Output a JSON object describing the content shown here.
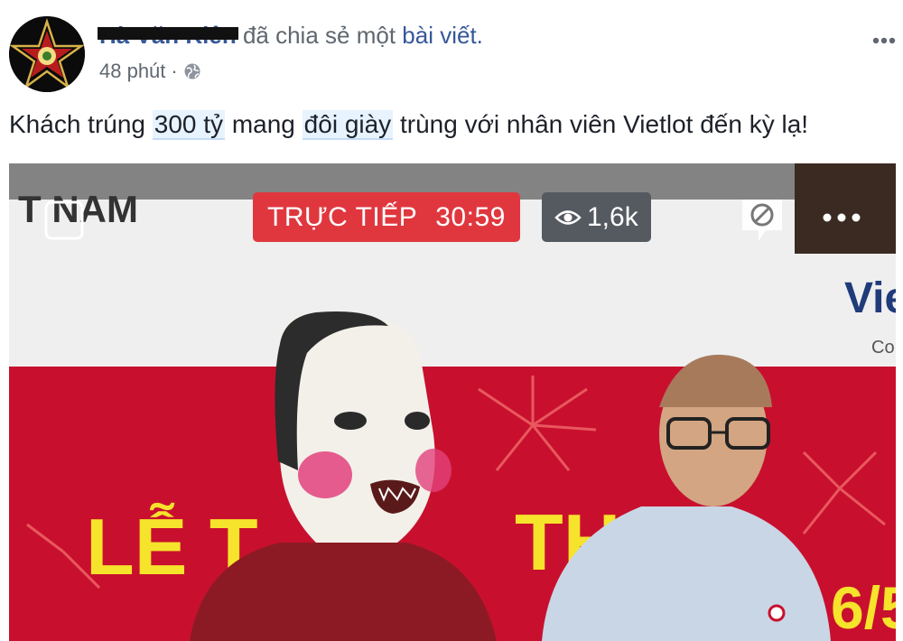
{
  "post": {
    "author_name": "Hà Văn Kiên",
    "action_text": "đã chia sẻ một",
    "action_link": "bài viết.",
    "time": "48 phút",
    "time_separator": "·",
    "menu_icon": "more-horizontal-icon",
    "privacy_icon": "globe-icon",
    "text_parts": [
      {
        "text": "Khách trúng ",
        "highlight": false
      },
      {
        "text": "300 tỷ",
        "highlight": true
      },
      {
        "text": " mang ",
        "highlight": false
      },
      {
        "text": "đôi giày",
        "highlight": true
      },
      {
        "text": " trùng với nhân viên Vietlot đến kỳ lạ!",
        "highlight": false
      }
    ]
  },
  "video": {
    "live_label": "TRỰC TIẾP",
    "live_time": "30:59",
    "views": "1,6k",
    "banner_text_left": "T NAM",
    "banner_brand": "Vie",
    "banner_brand_sub": "Co",
    "stage_text": "LỄ T",
    "stage_text_2": "THƯ",
    "stage_date": "6/5",
    "colors": {
      "live_badge": "#e0373f",
      "views_badge": "#555a60",
      "backdrop_red": "#c8102e",
      "stage_yellow": "#f6e32b"
    }
  }
}
